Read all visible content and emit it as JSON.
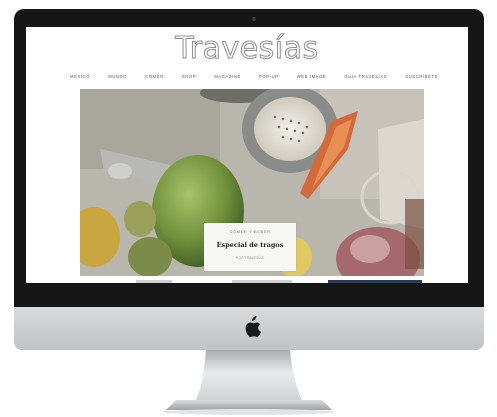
{
  "site": {
    "logo": "Travesías",
    "nav": [
      "MÉXICO",
      "MUNDO",
      "COMER",
      "SHOP",
      "MAGAZINE",
      "POP-UP",
      "WEB IMAGE",
      "GUÍA TRAVESÍAS",
      "SUSCRÍBETE"
    ]
  },
  "feature": {
    "category": "COMER Y BEBER",
    "title": "Especial de tragos",
    "meta": "POR TRAVESÍAS"
  },
  "colors": {
    "bezel": "#161616",
    "chin": "#c8cbcd",
    "accent_bar": "#2c3a55"
  }
}
